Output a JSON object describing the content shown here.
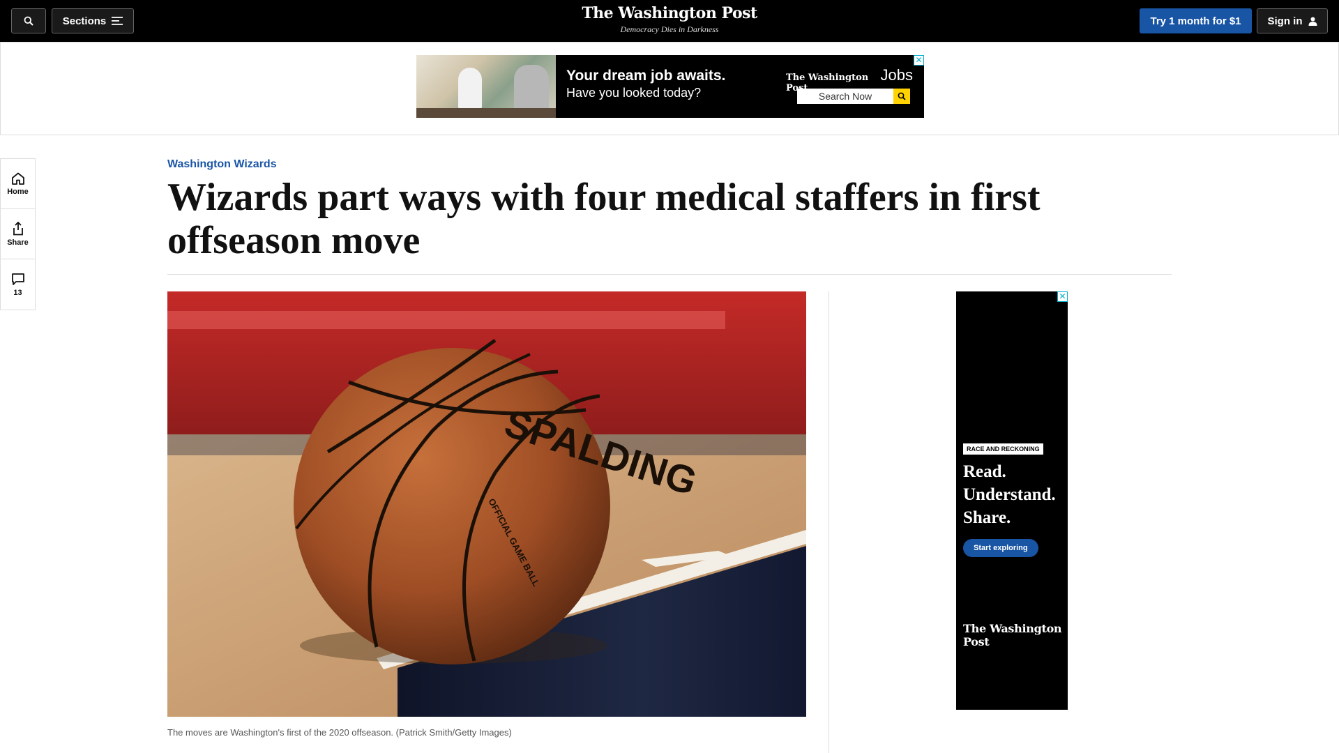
{
  "header": {
    "sections_label": "Sections",
    "logo": "The Washington Post",
    "tagline": "Democracy Dies in Darkness",
    "subscribe_label": "Try 1 month for $1",
    "signin_label": "Sign in"
  },
  "top_ad": {
    "line1": "Your dream job awaits.",
    "line2": "Have you looked today?",
    "brand": "The Washington Post",
    "brand_suffix": "Jobs",
    "search_label": "Search Now",
    "close": "✕"
  },
  "rail": {
    "home": "Home",
    "share": "Share",
    "comments": "13"
  },
  "article": {
    "kicker": "Washington Wizards",
    "headline": "Wizards part ways with four medical staffers in first offseason move",
    "caption": "The moves are Washington's first of the 2020 offseason. (Patrick Smith/Getty Images)",
    "ball_brand": "SPALDING",
    "ball_text": "OFFICIAL GAME BALL"
  },
  "side_ad": {
    "badge": "RACE AND RECKONING",
    "line1": "Read.",
    "line2": "Understand.",
    "line3": "Share.",
    "cta": "Start exploring",
    "brand": "The Washington Post",
    "close": "✕"
  },
  "colors": {
    "accent_blue": "#1955a5",
    "header_bg": "#000000",
    "search_yellow": "#ffd200"
  }
}
